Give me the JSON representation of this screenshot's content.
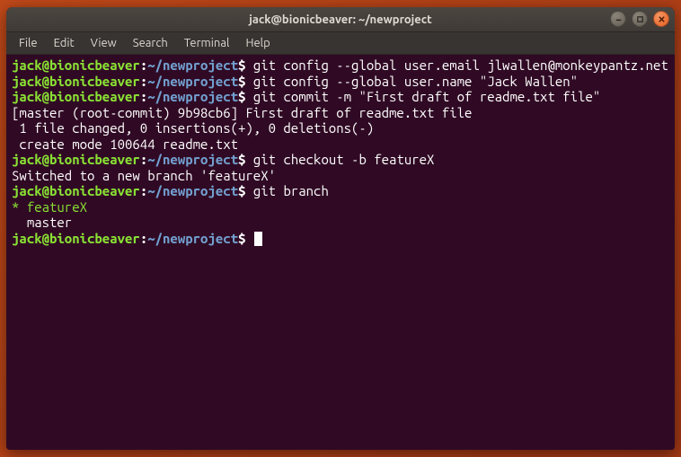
{
  "window": {
    "title": "jack@bionicbeaver: ~/newproject"
  },
  "menu": {
    "items": [
      "File",
      "Edit",
      "View",
      "Search",
      "Terminal",
      "Help"
    ]
  },
  "prompt": {
    "user_host": "jack@bionicbeaver",
    "sep1": ":",
    "path": "~/newproject",
    "sigil": "$"
  },
  "session": [
    {
      "type": "cmd",
      "text": "git config --global user.email jlwallen@monkeypantz.net"
    },
    {
      "type": "cmd",
      "text": "git config --global user.name \"Jack Wallen\""
    },
    {
      "type": "cmd",
      "text": "git commit -m \"First draft of readme.txt file\""
    },
    {
      "type": "out",
      "text": "[master (root-commit) 9b98cb6] First draft of readme.txt file"
    },
    {
      "type": "out",
      "text": " 1 file changed, 0 insertions(+), 0 deletions(-)"
    },
    {
      "type": "out",
      "text": " create mode 100644 readme.txt"
    },
    {
      "type": "cmd",
      "text": "git checkout -b featureX"
    },
    {
      "type": "out",
      "text": "Switched to a new branch 'featureX'"
    },
    {
      "type": "cmd",
      "text": "git branch"
    },
    {
      "type": "branch_current",
      "text": "* featureX"
    },
    {
      "type": "out",
      "text": "  master"
    },
    {
      "type": "cmd_cursor",
      "text": ""
    }
  ]
}
